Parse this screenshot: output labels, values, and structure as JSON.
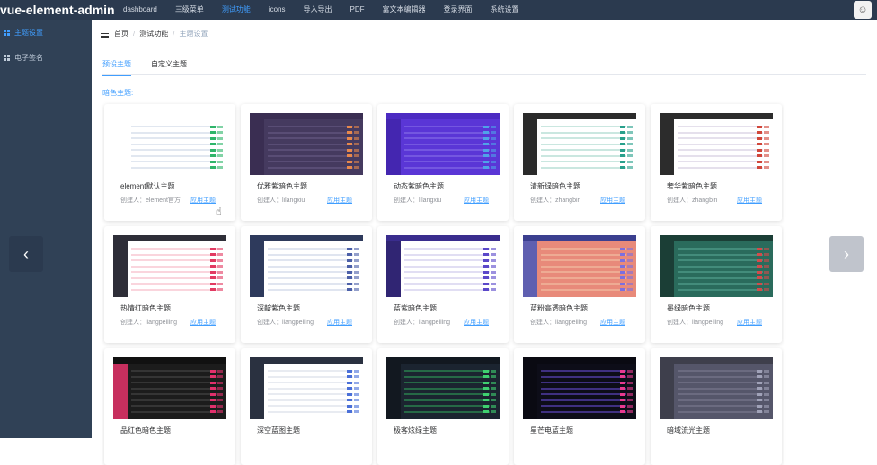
{
  "header": {
    "brand": "vue-element-admin",
    "nav": [
      {
        "label": "dashboard",
        "active": false
      },
      {
        "label": "三级菜单",
        "active": false
      },
      {
        "label": "测试功能",
        "active": true
      },
      {
        "label": "icons",
        "active": false
      },
      {
        "label": "导入导出",
        "active": false
      },
      {
        "label": "PDF",
        "active": false
      },
      {
        "label": "富文本编辑器",
        "active": false
      },
      {
        "label": "登录界面",
        "active": false
      },
      {
        "label": "系统设置",
        "active": false
      }
    ],
    "avatar_icon": "user-avatar"
  },
  "sidebar": {
    "items": [
      {
        "label": "主题设置",
        "active": true,
        "icon": "grid-icon"
      },
      {
        "label": "电子签名",
        "active": false,
        "icon": "grid-icon"
      }
    ]
  },
  "breadcrumb": {
    "items": [
      "首页",
      "测试功能",
      "主题设置"
    ],
    "separator": "/"
  },
  "tabs": [
    {
      "label": "预设主题",
      "active": true
    },
    {
      "label": "自定义主题",
      "active": false
    }
  ],
  "section_title": "暗色主题:",
  "apply_label": "应用主题",
  "cards": [
    {
      "title": "element默认主题",
      "creator": "创建人：element官方",
      "head": "#ffffff",
      "side": "#ffffff",
      "body": "#ffffff",
      "row": "#c9d4e3",
      "accent": "#2fb56a"
    },
    {
      "title": "优雅紫暗色主题",
      "creator": "创建人：lilangxiu",
      "head": "#3a2e52",
      "side": "#3a2e52",
      "body": "#453a5f",
      "row": "#6a5c86",
      "accent": "#e8884b"
    },
    {
      "title": "动态紫暗色主题",
      "creator": "创建人：lilangxiu",
      "head": "#4c2bc2",
      "side": "#4426b0",
      "body": "#5a36d6",
      "row": "#8b72ea",
      "accent": "#4fa3e8"
    },
    {
      "title": "清新绿暗色主题",
      "creator": "创建人：zhangbin",
      "head": "#2b2b2b",
      "side": "#2b2b2b",
      "body": "#ffffff",
      "row": "#9fd3c7",
      "accent": "#28a08c"
    },
    {
      "title": "奢华紫暗色主题",
      "creator": "创建人：zhangbin",
      "head": "#2c2c2c",
      "side": "#2c2c2c",
      "body": "#ffffff",
      "row": "#cfc6dd",
      "accent": "#d1463a"
    },
    {
      "title": "热情红暗色主题",
      "creator": "创建人：liangpeiling",
      "head": "#2e2e38",
      "side": "#2e2e38",
      "body": "#ffffff",
      "row": "#f5b3c1",
      "accent": "#e23a62"
    },
    {
      "title": "深靛紫色主题",
      "creator": "创建人：liangpeiling",
      "head": "#2e3a5c",
      "side": "#2e3a5c",
      "body": "#ffffff",
      "row": "#c7cfe3",
      "accent": "#4b5fa8"
    },
    {
      "title": "蓝紫暗色主题",
      "creator": "创建人：liangpeiling",
      "head": "#3a2d8e",
      "side": "#302573",
      "body": "#ffffff",
      "row": "#c9c2ea",
      "accent": "#5a47c9"
    },
    {
      "title": "蓝粉高透暗色主题",
      "creator": "创建人：liangpeiling",
      "head": "#3b3f8f",
      "side": "#5f5fb0",
      "body": "#e88a7a",
      "row": "#f2c7a8",
      "accent": "#7b6fe0"
    },
    {
      "title": "墨绿暗色主题",
      "creator": "创建人：liangpeiling",
      "head": "#1b3e36",
      "side": "#1b3e36",
      "body": "#2a6b5c",
      "row": "#58a896",
      "accent": "#d44a4a"
    },
    {
      "title": "品红色暗色主题",
      "creator": "",
      "head": "#111111",
      "side": "#c72f5e",
      "body": "#1c1c1c",
      "row": "#4a4a4a",
      "accent": "#e2306c"
    },
    {
      "title": "深空蓝图主题",
      "creator": "",
      "head": "#2a3140",
      "side": "#2a3140",
      "body": "#ffffff",
      "row": "#d5dbe6",
      "accent": "#4a6fd8"
    },
    {
      "title": "极客炫绿主题",
      "creator": "",
      "head": "#121820",
      "side": "#121820",
      "body": "#1b2430",
      "row": "#2fa35a",
      "accent": "#3fd070"
    },
    {
      "title": "星芒电蓝主题",
      "creator": "",
      "head": "#0a0a12",
      "side": "#0a0a12",
      "body": "#0d0d18",
      "row": "#6a4fd8",
      "accent": "#e83a8f"
    },
    {
      "title": "暗域流光主题",
      "creator": "",
      "head": "#3e3f4c",
      "side": "#3e3f4c",
      "body": "#55566a",
      "row": "#7d7e92",
      "accent": "#a0a2b8"
    }
  ],
  "carousel": {
    "prev_icon": "chevron-left-icon",
    "next_icon": "chevron-right-icon"
  }
}
